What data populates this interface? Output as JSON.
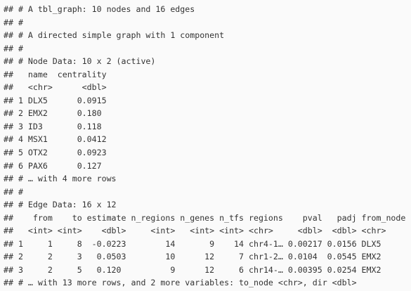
{
  "output_lines": [
    "## # A tbl_graph: 10 nodes and 16 edges",
    "## #",
    "## # A directed simple graph with 1 component",
    "## #",
    "## # Node Data: 10 x 2 (active)",
    "##   name  centrality",
    "##   <chr>      <dbl>",
    "## 1 DLX5      0.0915",
    "## 2 EMX2      0.180",
    "## 3 ID3       0.118",
    "## 4 MSX1      0.0412",
    "## 5 OTX2      0.0923",
    "## 6 PAX6      0.127",
    "## # … with 4 more rows",
    "## #",
    "## # Edge Data: 16 x 12",
    "##    from    to estimate n_regions n_genes n_tfs regions    pval   padj from_node",
    "##   <int> <int>    <dbl>     <int>   <int> <int> <chr>     <dbl>  <dbl> <chr>",
    "## 1     1     8  -0.0223        14       9    14 chr4-1… 0.00217 0.0156 DLX5",
    "## 2     2     3   0.0503        10      12     7 chr1-2… 0.0104  0.0545 EMX2",
    "## 3     2     5   0.120          9      12     6 chr14-… 0.00395 0.0254 EMX2",
    "## # … with 13 more rows, and 2 more variables: to_node <chr>, dir <dbl>"
  ]
}
